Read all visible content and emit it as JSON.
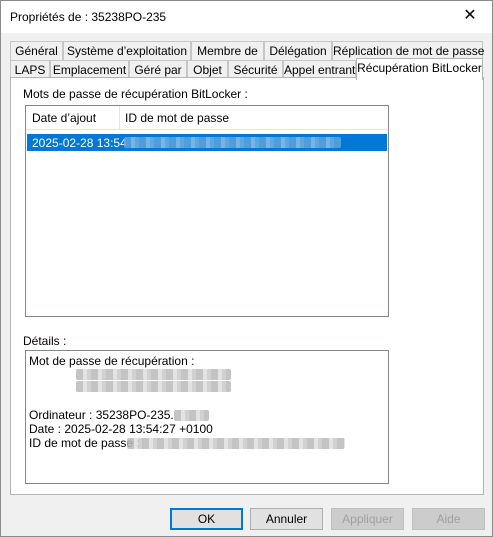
{
  "window": {
    "title": "Propriétés de : 35238PO-235",
    "close_glyph": "✕"
  },
  "tabs": {
    "row_back": [
      "Général",
      "Système d’exploitation",
      "Membre de",
      "Délégation",
      "Réplication de mot de passe"
    ],
    "row_front": [
      "LAPS",
      "Emplacement",
      "Géré par",
      "Objet",
      "Sécurité",
      "Appel entrant",
      "Récupération BitLocker"
    ],
    "active": "Récupération BitLocker"
  },
  "recovery": {
    "section_label": "Mots de passe de récupération BitLocker :",
    "columns": [
      "Date d’ajout",
      "ID de mot de passe"
    ],
    "rows": [
      {
        "date": "2025-02-28 13:54",
        "id_redacted": true
      }
    ]
  },
  "details": {
    "section_label": "Détails :",
    "recovery_password_label": "Mot de passe de récupération :",
    "computer_label": "Ordinateur : 35238PO-235.",
    "date_line": "Date : 2025-02-28 13:54:27 +0100",
    "password_id_label": "ID de mot de passe :"
  },
  "buttons": {
    "ok": "OK",
    "cancel": "Annuler",
    "apply": "Appliquer",
    "help": "Aide"
  },
  "colors": {
    "selection": "#0078d7",
    "window_bg": "#f0f0f0"
  }
}
